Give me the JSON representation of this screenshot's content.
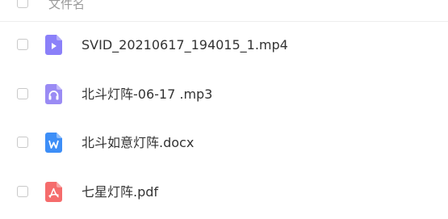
{
  "list": {
    "header": {
      "column_label": "文件名"
    },
    "files": [
      {
        "name": "SVID_20210617_194015_1.mp4",
        "icon": "video-file-icon",
        "color": "#8B80F9"
      },
      {
        "name": "北斗灯阵-06-17 .mp3",
        "icon": "audio-file-icon",
        "color": "#9A8BF4"
      },
      {
        "name": "北斗如意灯阵.docx",
        "icon": "word-file-icon",
        "color": "#3D8EF7"
      },
      {
        "name": "七星灯阵.pdf",
        "icon": "pdf-file-icon",
        "color": "#F56C6C"
      }
    ]
  }
}
